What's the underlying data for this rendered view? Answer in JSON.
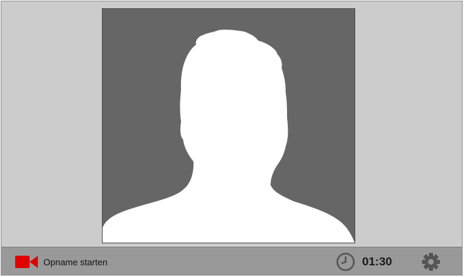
{
  "recorder": {
    "record_label": "Opname starten",
    "timer": "01:30",
    "icons": {
      "record": "video-camera-icon",
      "timer": "clock-icon",
      "settings": "gear-icon"
    },
    "colors": {
      "record_icon": "#e00000",
      "background": "#cccccc",
      "toolbar": "#999999",
      "preview": "#666666"
    }
  }
}
